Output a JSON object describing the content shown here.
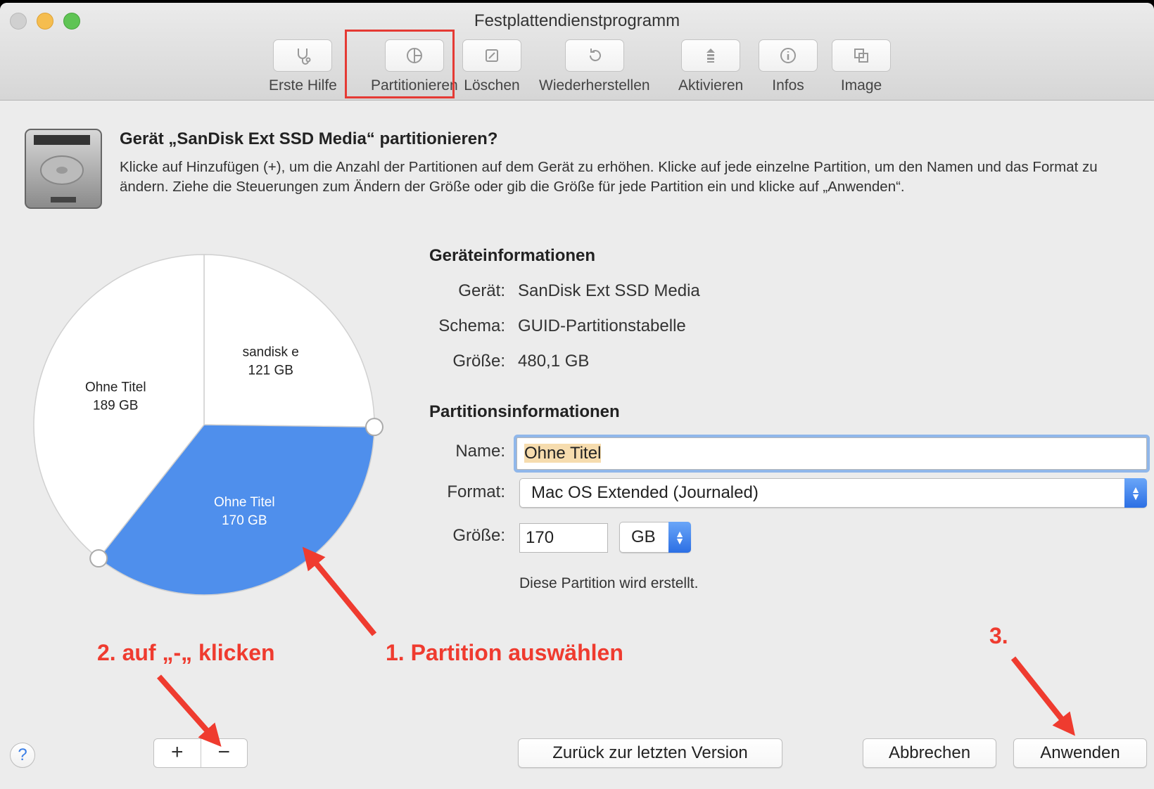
{
  "window": {
    "title": "Festplattendienstprogramm"
  },
  "toolbar": {
    "items": [
      {
        "label": "Erste Hilfe",
        "icon": "stethoscope-icon"
      },
      {
        "label": "Partitionieren",
        "icon": "partition-icon"
      },
      {
        "label": "Löschen",
        "icon": "erase-icon"
      },
      {
        "label": "Wiederherstellen",
        "icon": "restore-icon"
      },
      {
        "label": "Aktivieren",
        "icon": "mount-icon"
      },
      {
        "label": "Infos",
        "icon": "info-icon"
      },
      {
        "label": "Image",
        "icon": "image-icon"
      }
    ]
  },
  "header": {
    "title": "Gerät „SanDisk Ext SSD Media“ partitionieren?",
    "description": "Klicke auf Hinzufügen (+), um die Anzahl der Partitionen auf dem Gerät zu erhöhen. Klicke auf jede einzelne Partition, um den Namen und das Format zu ändern. Ziehe die Steuerungen zum Ändern der Größe oder gib die Größe für jede Partition ein und klicke auf „Anwenden“."
  },
  "pie": {
    "partitions": [
      {
        "name": "sandisk e",
        "size": "121 GB",
        "value": 121,
        "selected": false,
        "color": "#ffffff"
      },
      {
        "name": "Ohne Titel",
        "size": "170 GB",
        "value": 170,
        "selected": true,
        "color": "#4f8fec"
      },
      {
        "name": "Ohne Titel",
        "size": "189 GB",
        "value": 189,
        "selected": false,
        "color": "#ffffff"
      }
    ]
  },
  "device_info": {
    "title": "Geräteinformationen",
    "device_label": "Gerät:",
    "device_value": "SanDisk Ext SSD Media",
    "scheme_label": "Schema:",
    "scheme_value": "GUID-Partitionstabelle",
    "size_label": "Größe:",
    "size_value": "480,1 GB"
  },
  "partition_info": {
    "title": "Partitionsinformationen",
    "name_label": "Name:",
    "name_value": "Ohne Titel",
    "format_label": "Format:",
    "format_value": "Mac OS Extended (Journaled)",
    "size_label": "Größe:",
    "size_value": "170",
    "unit_value": "GB",
    "note": "Diese Partition wird erstellt."
  },
  "bottom": {
    "help": "?",
    "add": "+",
    "remove": "−",
    "revert": "Zurück zur letzten Version",
    "cancel": "Abbrechen",
    "apply": "Anwenden"
  },
  "annotations": {
    "step1": "1. Partition auswählen",
    "step2": "2. auf „-„ klicken",
    "step3": "3.",
    "color": "#ef3b2f"
  },
  "colors": {
    "accent": "#2c6fe4",
    "highlight": "#e53a34",
    "selected_partition": "#4f8fec"
  }
}
